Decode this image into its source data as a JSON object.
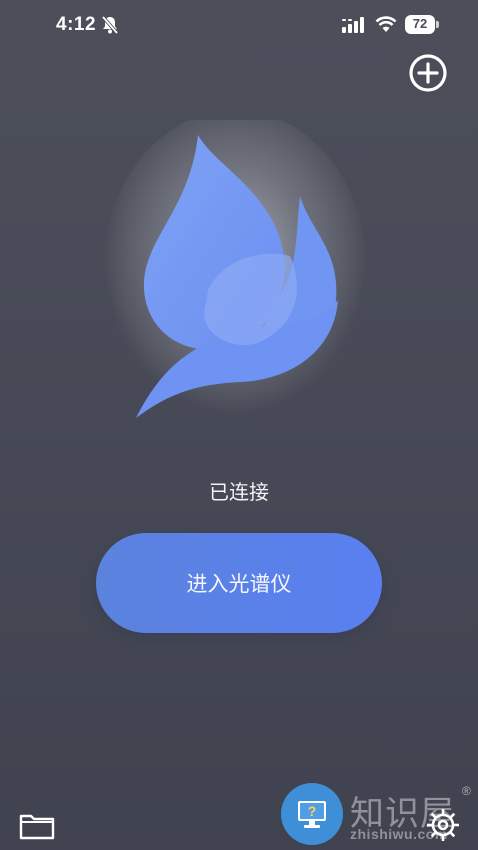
{
  "status_bar": {
    "time": "4:12",
    "battery_level": "72",
    "icons": [
      "bell-slash-icon",
      "signal-icon",
      "wifi-icon",
      "battery-icon"
    ]
  },
  "header": {
    "add_icon": "plus-circle-icon"
  },
  "main": {
    "logo_icon": "flame-logo-icon",
    "connection_status": "已连接",
    "enter_button_label": "进入光谱仪"
  },
  "bottom_bar": {
    "folder_icon": "folder-icon",
    "help_icon": "help-monitor-icon",
    "settings_icon": "gear-icon"
  },
  "watermark": {
    "text": "知识屋",
    "registered": "®",
    "url": "zhishiwu.com"
  },
  "colors": {
    "background": "#484b57",
    "accent": "#5a7ff0",
    "logo_blue": "#6d92f0",
    "help_button": "#3f8fd8"
  }
}
